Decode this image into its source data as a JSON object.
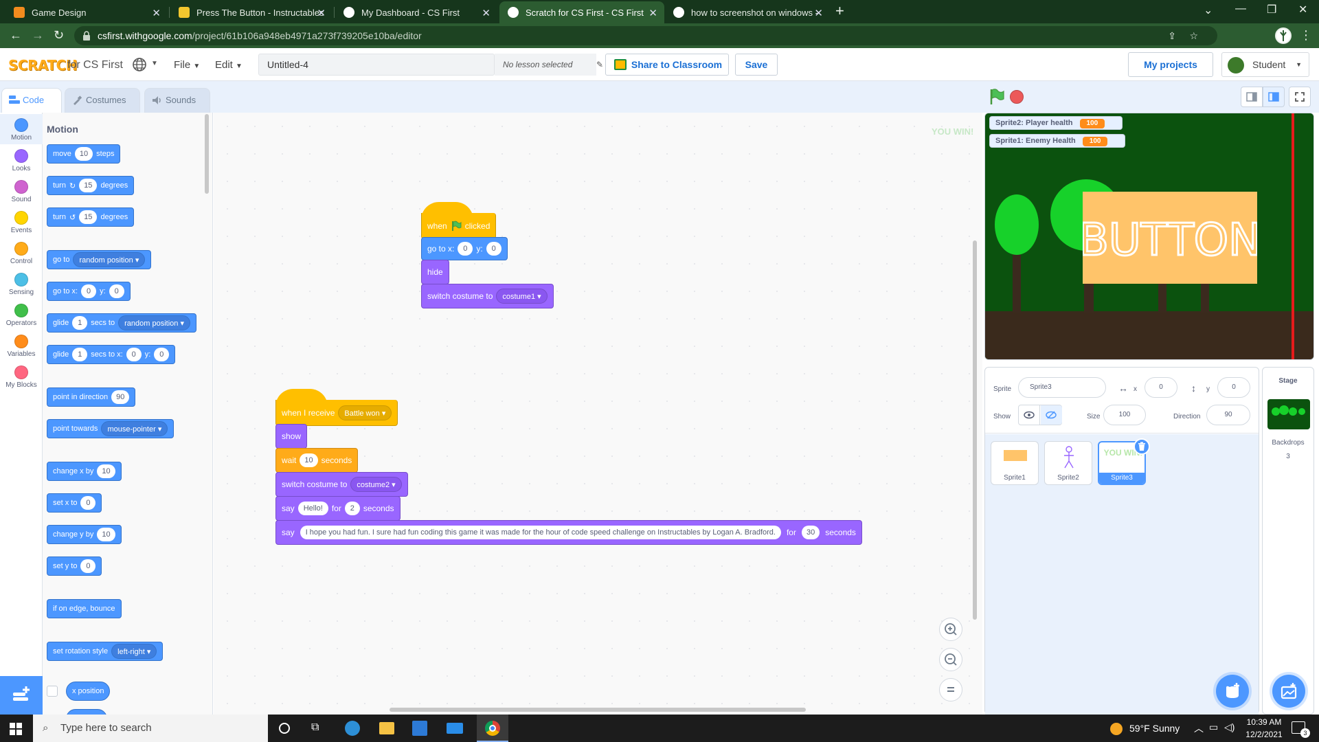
{
  "browser": {
    "tabs": [
      {
        "title": "Game Design"
      },
      {
        "title": "Press The Button - Instructables"
      },
      {
        "title": "My Dashboard - CS First"
      },
      {
        "title": "Scratch for CS First - CS First"
      },
      {
        "title": "how to screenshot on windows -"
      }
    ],
    "url_host": "csfirst.withgoogle.com",
    "url_path": "/project/61b106a948eb4971a273f739205e10ba/editor"
  },
  "header": {
    "logo": "SCRATCH",
    "for_cs_first": "for CS First",
    "menu_file": "File",
    "menu_edit": "Edit",
    "project_title": "Untitled-4",
    "lesson": "No lesson selected",
    "share_button": "Share to Classroom",
    "save_button": "Save",
    "my_projects": "My projects",
    "user": "Student"
  },
  "editor_tabs": {
    "code": "Code",
    "costumes": "Costumes",
    "sounds": "Sounds"
  },
  "categories": [
    {
      "label": "Motion",
      "color": "#4c97ff"
    },
    {
      "label": "Looks",
      "color": "#9966ff"
    },
    {
      "label": "Sound",
      "color": "#cf63cf"
    },
    {
      "label": "Events",
      "color": "#ffd500"
    },
    {
      "label": "Control",
      "color": "#ffab19"
    },
    {
      "label": "Sensing",
      "color": "#4cbfe6"
    },
    {
      "label": "Operators",
      "color": "#40bf4a"
    },
    {
      "label": "Variables",
      "color": "#ff8c1a"
    },
    {
      "label": "My Blocks",
      "color": "#ff6680"
    }
  ],
  "palette": {
    "title": "Motion",
    "move": "move",
    "move_steps": "10",
    "steps": "steps",
    "turn": "turn",
    "turn_deg": "15",
    "degrees": "degrees",
    "goto": "go to",
    "random_position": "random position",
    "goto_xy": "go to x:",
    "zero": "0",
    "y_label": "y:",
    "glide": "glide",
    "one": "1",
    "secs_to": "secs to",
    "secs_to_x": "secs to x:",
    "point_dir": "point in direction",
    "ninety": "90",
    "point_towards": "point towards",
    "mouse_pointer": "mouse-pointer",
    "change_x": "change x by",
    "set_x": "set x to",
    "change_y": "change y by",
    "set_y": "set y to",
    "ten": "10",
    "bounce": "if on edge, bounce",
    "rotation": "set rotation style",
    "left_right": "left-right",
    "x_position": "x position"
  },
  "script1": {
    "when": "when",
    "clicked": "clicked",
    "goto": "go to x:",
    "x": "0",
    "y_label": "y:",
    "y": "0",
    "hide": "hide",
    "switch": "switch costume to",
    "costume": "costume1"
  },
  "script2": {
    "when_receive": "when I receive",
    "message": "Battle won",
    "show": "show",
    "wait": "wait",
    "wait_val": "10",
    "seconds": "seconds",
    "switch": "switch costume to",
    "costume": "costume2",
    "say": "say",
    "hello": "Hello!",
    "for": "for",
    "two": "2",
    "long_text": "I hope you had fun. I sure had fun coding this game it was made for the hour of code speed challenge on Instructables by Logan A. Bradford.",
    "thirty": "30"
  },
  "youwin": "YOU WIN!",
  "stage": {
    "monitors": [
      {
        "label": "Sprite2: Player health",
        "value": "100"
      },
      {
        "label": "Sprite1: Enemy Health",
        "value": "100"
      }
    ],
    "button_text": "BUTTON"
  },
  "sprite_info": {
    "sprite_label": "Sprite",
    "name": "Sprite3",
    "x_label": "x",
    "x": "0",
    "y_label": "y",
    "y": "0",
    "show_label": "Show",
    "size_label": "Size",
    "size": "100",
    "direction_label": "Direction",
    "direction": "90"
  },
  "sprites": [
    {
      "name": "Sprite1"
    },
    {
      "name": "Sprite2"
    },
    {
      "name": "Sprite3"
    }
  ],
  "stage_pane": {
    "title": "Stage",
    "backdrops_label": "Backdrops",
    "backdrops_count": "3"
  },
  "taskbar": {
    "search": "Type here to search",
    "weather": "59°F  Sunny",
    "time": "10:39 AM",
    "date": "12/2/2021",
    "notifications": "3"
  }
}
